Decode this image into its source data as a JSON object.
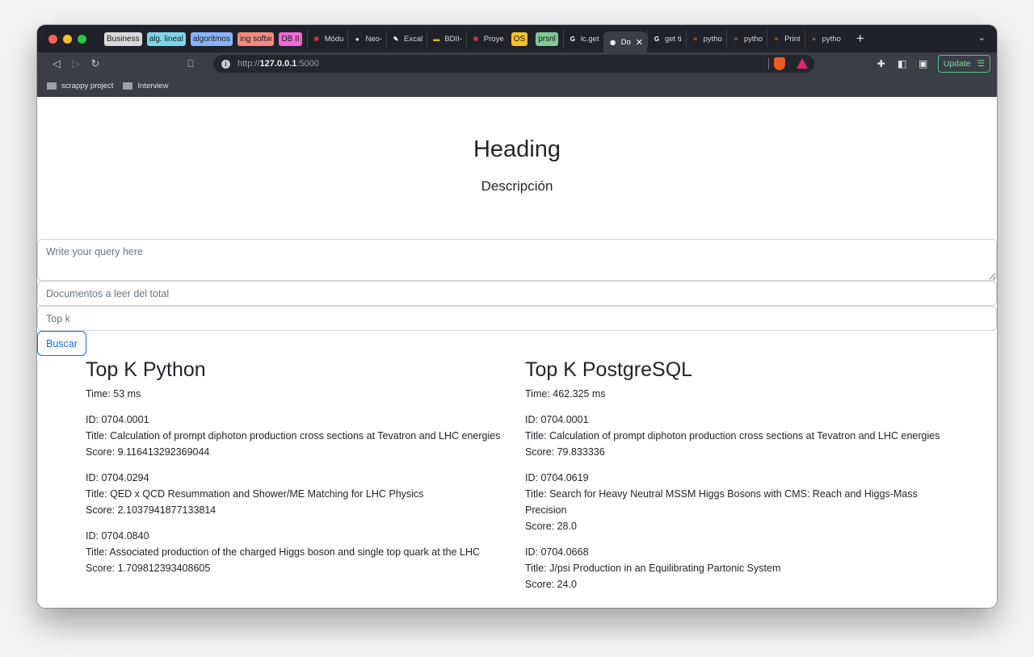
{
  "browser": {
    "tab_groups": [
      {
        "label": "Business",
        "color": "#d9d9d9"
      },
      {
        "label": "alg. lineal",
        "color": "#7fd4e8"
      },
      {
        "label": "algoritmos",
        "color": "#8ab4f8"
      },
      {
        "label": "ing softw",
        "color": "#f28b82"
      },
      {
        "label": "DB II",
        "color": "#f06bd8"
      }
    ],
    "tabs": [
      {
        "label": "Módu",
        "icon": "asterisk-icon",
        "icon_color": "#e8413d"
      },
      {
        "label": "Neo-",
        "icon": "github-icon",
        "icon_color": "#ffffff"
      },
      {
        "label": "Excal",
        "icon": "excalidraw-icon",
        "icon_color": "#ffffff"
      },
      {
        "label": "BDII-",
        "icon": "slides-icon",
        "icon_color": "#f6b400"
      },
      {
        "label": "Proye",
        "icon": "asterisk-icon",
        "icon_color": "#e8413d"
      },
      {
        "label": "OS",
        "group": true,
        "color": "#fbc02d"
      },
      {
        "label": "prsnl",
        "group": true,
        "color": "#81c995"
      },
      {
        "label": "lc.get",
        "icon": "google-icon",
        "icon_color": "#ffffff"
      },
      {
        "label": "Do",
        "icon": "globe-icon",
        "icon_color": "#ffffff",
        "active": true
      },
      {
        "label": "get ti",
        "icon": "google-icon",
        "icon_color": "#ffffff"
      },
      {
        "label": "pytho",
        "icon": "stackoverflow-icon",
        "icon_color": "#f48024"
      },
      {
        "label": "pytho",
        "icon": "stackoverflow-icon",
        "icon_color": "#f48024"
      },
      {
        "label": "Print",
        "icon": "stackoverflow-icon",
        "icon_color": "#f48024"
      },
      {
        "label": "pytho",
        "icon": "stackoverflow-icon",
        "icon_color": "#f48024"
      }
    ],
    "close_glyph": "✕",
    "new_tab_glyph": "+",
    "tab_menu_glyph": "⌄",
    "url_host": "127.0.0.1",
    "url_scheme": "http://",
    "url_port": ":5000",
    "update_label": "Update",
    "bookmarks": [
      "scrappy project",
      "Interview"
    ]
  },
  "page": {
    "heading": "Heading",
    "description": "Descripción",
    "query_placeholder": "Write your query here",
    "docs_placeholder": "Documentos a leer del total",
    "topk_placeholder": "Top k",
    "search_label": "Buscar"
  },
  "results": {
    "python": {
      "title": "Top K Python",
      "time": "Time: 53 ms",
      "items": [
        {
          "id": "ID: 0704.0001",
          "title": "Title: Calculation of prompt diphoton production cross sections at Tevatron and LHC energies",
          "score": "Score: 9.116413292369044"
        },
        {
          "id": "ID: 0704.0294",
          "title": "Title: QED x QCD Resummation and Shower/ME Matching for LHC Physics",
          "score": "Score: 2.1037941877133814"
        },
        {
          "id": "ID: 0704.0840",
          "title": "Title: Associated production of the charged Higgs boson and single top quark at the LHC",
          "score": "Score: 1.709812393408605"
        }
      ]
    },
    "postgres": {
      "title": "Top K PostgreSQL",
      "time": "Time: 462.325 ms",
      "items": [
        {
          "id": "ID: 0704.0001",
          "title": "Title: Calculation of prompt diphoton production cross sections at Tevatron and LHC energies",
          "score": "Score: 79.833336"
        },
        {
          "id": "ID: 0704.0619",
          "title": "Title: Search for Heavy Neutral MSSM Higgs Bosons with CMS: Reach and Higgs-Mass Precision",
          "score": "Score: 28.0"
        },
        {
          "id": "ID: 0704.0668",
          "title": "Title: J/psi Production in an Equilibrating Partonic System",
          "score": "Score: 24.0"
        }
      ]
    }
  }
}
